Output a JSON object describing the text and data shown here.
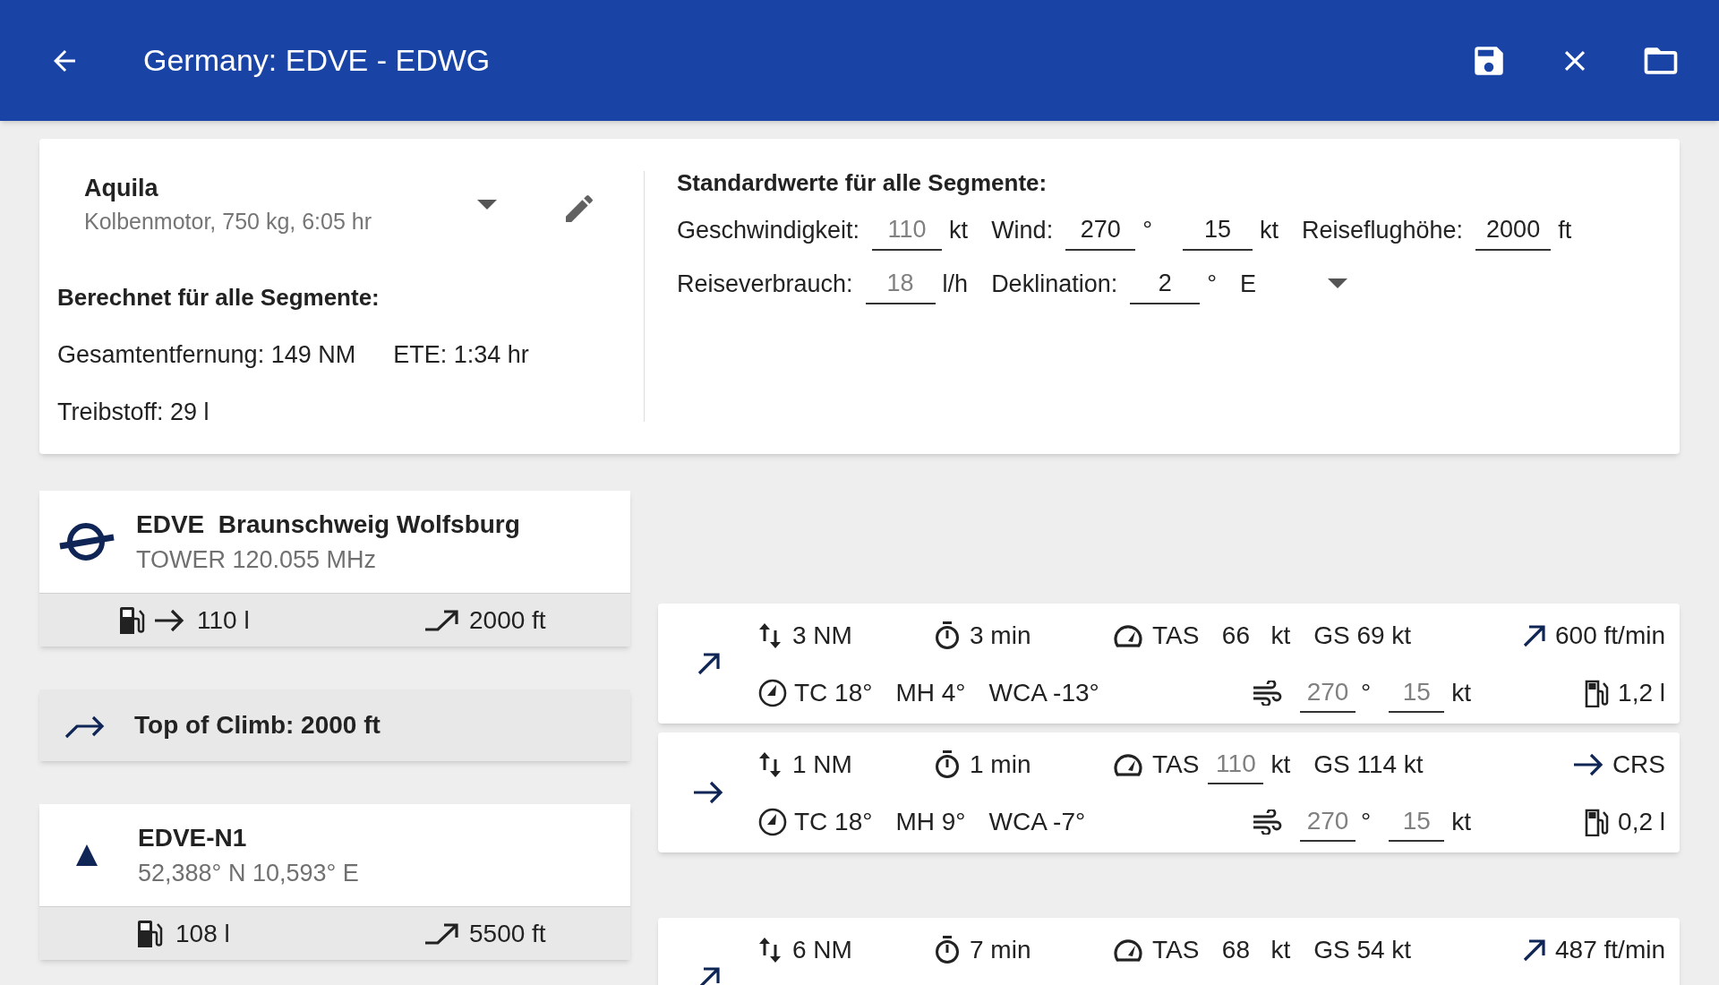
{
  "app_bar": {
    "title": "Germany: EDVE - EDWG"
  },
  "aircraft": {
    "name": "Aquila",
    "details": "Kolbenmotor, 750 kg, 6:05 hr"
  },
  "computed": {
    "heading": "Berechnet für alle Segmente:",
    "rows": [
      [
        "Gesamtentfernung: 149 NM",
        "ETE: 1:34 hr"
      ],
      [
        "Treibstoff: 29 l"
      ]
    ]
  },
  "defaults": {
    "heading": "Standardwerte für alle Segmente:",
    "lines": [
      {
        "items": [
          {
            "kind": "label",
            "text": "Geschwindigkeit:"
          },
          {
            "kind": "field",
            "placeholder": "110"
          },
          {
            "kind": "unit",
            "text": "kt"
          },
          {
            "kind": "label",
            "text": "Wind:"
          },
          {
            "kind": "field",
            "value": "270"
          },
          {
            "kind": "unit",
            "text": "°"
          },
          {
            "kind": "field",
            "value": "15"
          },
          {
            "kind": "unit",
            "text": "kt"
          },
          {
            "kind": "label",
            "text": "Reiseflughöhe:"
          },
          {
            "kind": "field",
            "value": "2000"
          },
          {
            "kind": "unit",
            "text": "ft"
          }
        ]
      },
      {
        "items": [
          {
            "kind": "label",
            "text": "Reiseverbrauch:"
          },
          {
            "kind": "field",
            "placeholder": "18"
          },
          {
            "kind": "unit",
            "text": "l/h"
          },
          {
            "kind": "label",
            "text": "Deklination:"
          },
          {
            "kind": "field",
            "value": "2"
          },
          {
            "kind": "unit",
            "text": "°"
          },
          {
            "kind": "dropdown",
            "text": "E"
          }
        ]
      }
    ]
  },
  "waypoints": [
    {
      "kind": "airport",
      "title": "EDVE  Braunschweig Wolfsburg",
      "subtitle": "TOWER 120.055 MHz",
      "refuel": true,
      "fuel": "110 l",
      "altitude": "2000 ft"
    },
    {
      "kind": "toc",
      "title": "Top of Climb: 2000 ft"
    },
    {
      "kind": "waypoint",
      "title": "EDVE-N1",
      "subtitle": "52,388° N 10,593° E",
      "refuel": false,
      "fuel": "108 l",
      "altitude": "5500 ft"
    }
  ],
  "segments": [
    {
      "kind": "climb",
      "distance": "3 NM",
      "time": "3 min",
      "tas_label": "TAS",
      "tas": {
        "kind": "text",
        "value": "66"
      },
      "tas_unit": "kt",
      "gs": "GS 69 kt",
      "vertical": {
        "kind": "climb",
        "text": "600 ft/min"
      },
      "tc": "TC 18°",
      "mh": "MH 4°",
      "wca": "WCA -13°",
      "wind": {
        "direction": {
          "placeholder": "270"
        },
        "degree": "°",
        "speed": {
          "placeholder": "15"
        },
        "unit": "kt"
      },
      "fuel": "1,2 l"
    },
    {
      "kind": "cruise",
      "distance": "1 NM",
      "time": "1 min",
      "tas_label": "TAS",
      "tas": {
        "kind": "field",
        "placeholder": "110"
      },
      "tas_unit": "kt",
      "gs": "GS 114 kt",
      "vertical": {
        "kind": "cruise",
        "text": "CRS"
      },
      "tc": "TC 18°",
      "mh": "MH 9°",
      "wca": "WCA -7°",
      "wind": {
        "direction": {
          "placeholder": "270"
        },
        "degree": "°",
        "speed": {
          "placeholder": "15"
        },
        "unit": "kt"
      },
      "fuel": "0,2 l"
    },
    {
      "kind": "climb",
      "distance": "6 NM",
      "time": "7 min",
      "tas_label": "TAS",
      "tas": {
        "kind": "text",
        "value": "68"
      },
      "tas_unit": "kt",
      "gs": "GS 54 kt",
      "vertical": {
        "kind": "climb",
        "text": "487 ft/min"
      }
    }
  ]
}
